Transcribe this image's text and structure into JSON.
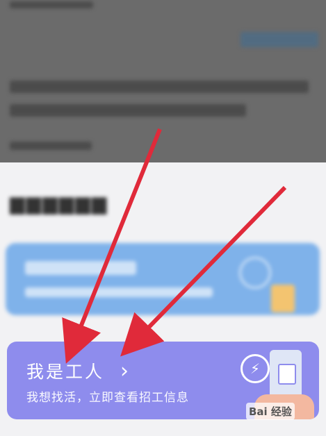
{
  "worker_option": {
    "title": "我是工人",
    "subtitle": "我想找活，立即查看招工信息",
    "chevron": "›"
  },
  "colors": {
    "dim_overlay": "#6b6b6b",
    "boss_card": "#7fb2ea",
    "worker_card": "#8e8ced",
    "arrow": "#e02a3a"
  },
  "icons": [
    "lightning-icon",
    "phone-illustration",
    "chevron-right-icon",
    "hand-illustration"
  ],
  "watermark": {
    "text": "Bai 经验"
  }
}
